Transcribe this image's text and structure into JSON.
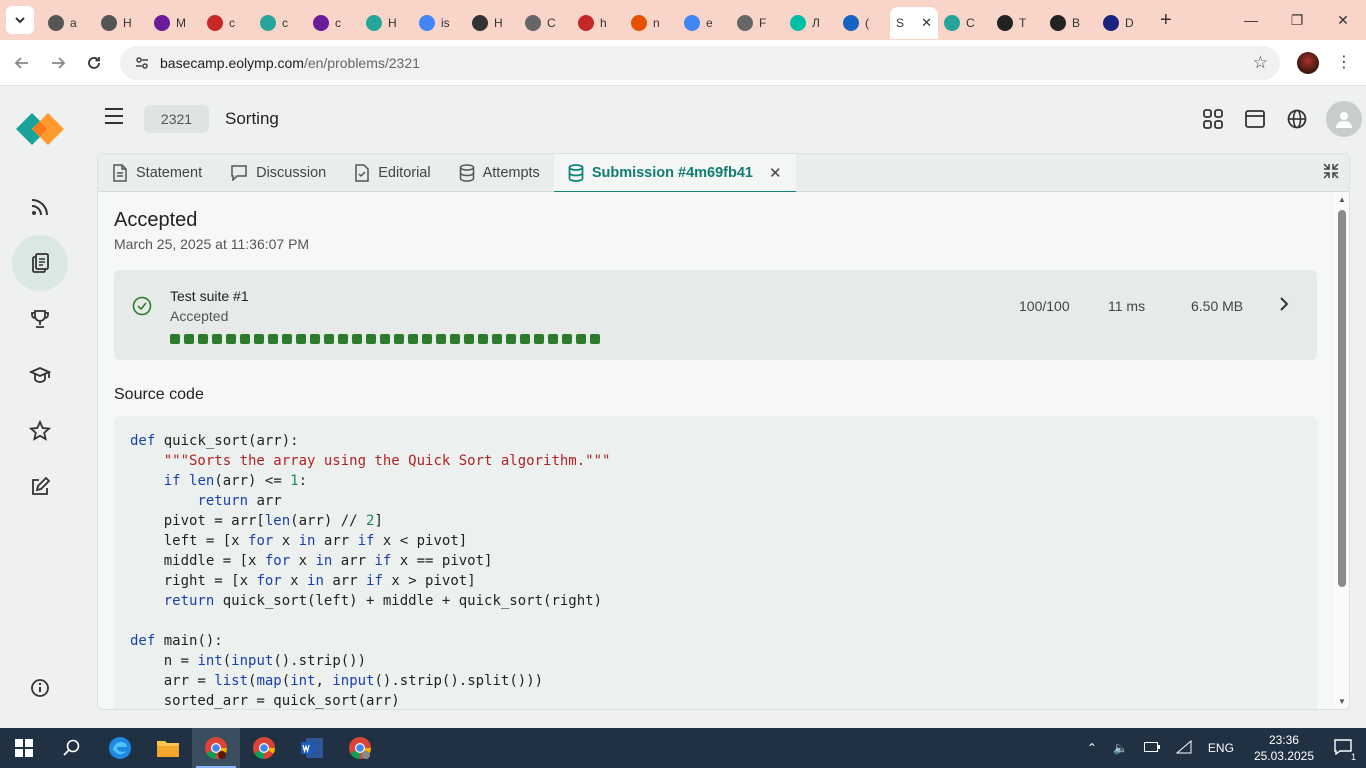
{
  "browser": {
    "tabs": [
      {
        "label": "a",
        "color": "#555"
      },
      {
        "label": "H",
        "color": "#555"
      },
      {
        "label": "M",
        "color": "#6a1b9a"
      },
      {
        "label": "c",
        "color": "#c62828"
      },
      {
        "label": "c",
        "color": "#26a69a"
      },
      {
        "label": "c",
        "color": "#6a1b9a"
      },
      {
        "label": "H",
        "color": "#26a69a"
      },
      {
        "label": "is",
        "color": "#4285f4"
      },
      {
        "label": "H",
        "color": "#333"
      },
      {
        "label": "C",
        "color": "#666"
      },
      {
        "label": "h",
        "color": "#c62828"
      },
      {
        "label": "n",
        "color": "#e65100"
      },
      {
        "label": "e",
        "color": "#4285f4"
      },
      {
        "label": "F",
        "color": "#666"
      },
      {
        "label": "Л",
        "color": "#00bfa5"
      },
      {
        "label": "(",
        "color": "#1565c0"
      },
      {
        "label": "S",
        "color": "#fff",
        "active": true
      },
      {
        "label": "C",
        "color": "#26a69a"
      },
      {
        "label": "T",
        "color": "#222"
      },
      {
        "label": "B",
        "color": "#222"
      },
      {
        "label": "D",
        "color": "#1a237e"
      }
    ],
    "url_host": "basecamp.eolymp.com",
    "url_path": "/en/problems/2321"
  },
  "header": {
    "problem_id": "2321",
    "problem_title": "Sorting"
  },
  "panel_tabs": [
    {
      "label": "Statement",
      "icon": "document-icon"
    },
    {
      "label": "Discussion",
      "icon": "chat-icon"
    },
    {
      "label": "Editorial",
      "icon": "editorial-icon"
    },
    {
      "label": "Attempts",
      "icon": "database-icon"
    },
    {
      "label": "Submission #4m69fb41",
      "icon": "database-icon",
      "active": true
    }
  ],
  "submission": {
    "verdict": "Accepted",
    "date": "March 25, 2025 at 11:36:07 PM",
    "suite": {
      "name": "Test suite #1",
      "status": "Accepted",
      "score": "100/100",
      "time": "11 ms",
      "memory": "6.50 MB",
      "tests_passed": 31,
      "tests_total": 31
    },
    "source_title": "Source code"
  },
  "code_lines": [
    "def quick_sort(arr):",
    "    \"\"\"Sorts the array using the Quick Sort algorithm.\"\"\"",
    "    if len(arr) <= 1:",
    "        return arr",
    "    pivot = arr[len(arr) // 2]",
    "    left = [x for x in arr if x < pivot]",
    "    middle = [x for x in arr if x == pivot]",
    "    right = [x for x in arr if x > pivot]",
    "    return quick_sort(left) + middle + quick_sort(right)",
    "",
    "def main():",
    "    n = int(input().strip())",
    "    arr = list(map(int, input().strip().split()))",
    "    sorted_arr = quick_sort(arr)"
  ],
  "taskbar": {
    "lang": "ENG",
    "time": "23:36",
    "date": "25.03.2025",
    "notifications": "1"
  },
  "colors": {
    "accent": "#12867a",
    "success": "#2c7a2c"
  }
}
